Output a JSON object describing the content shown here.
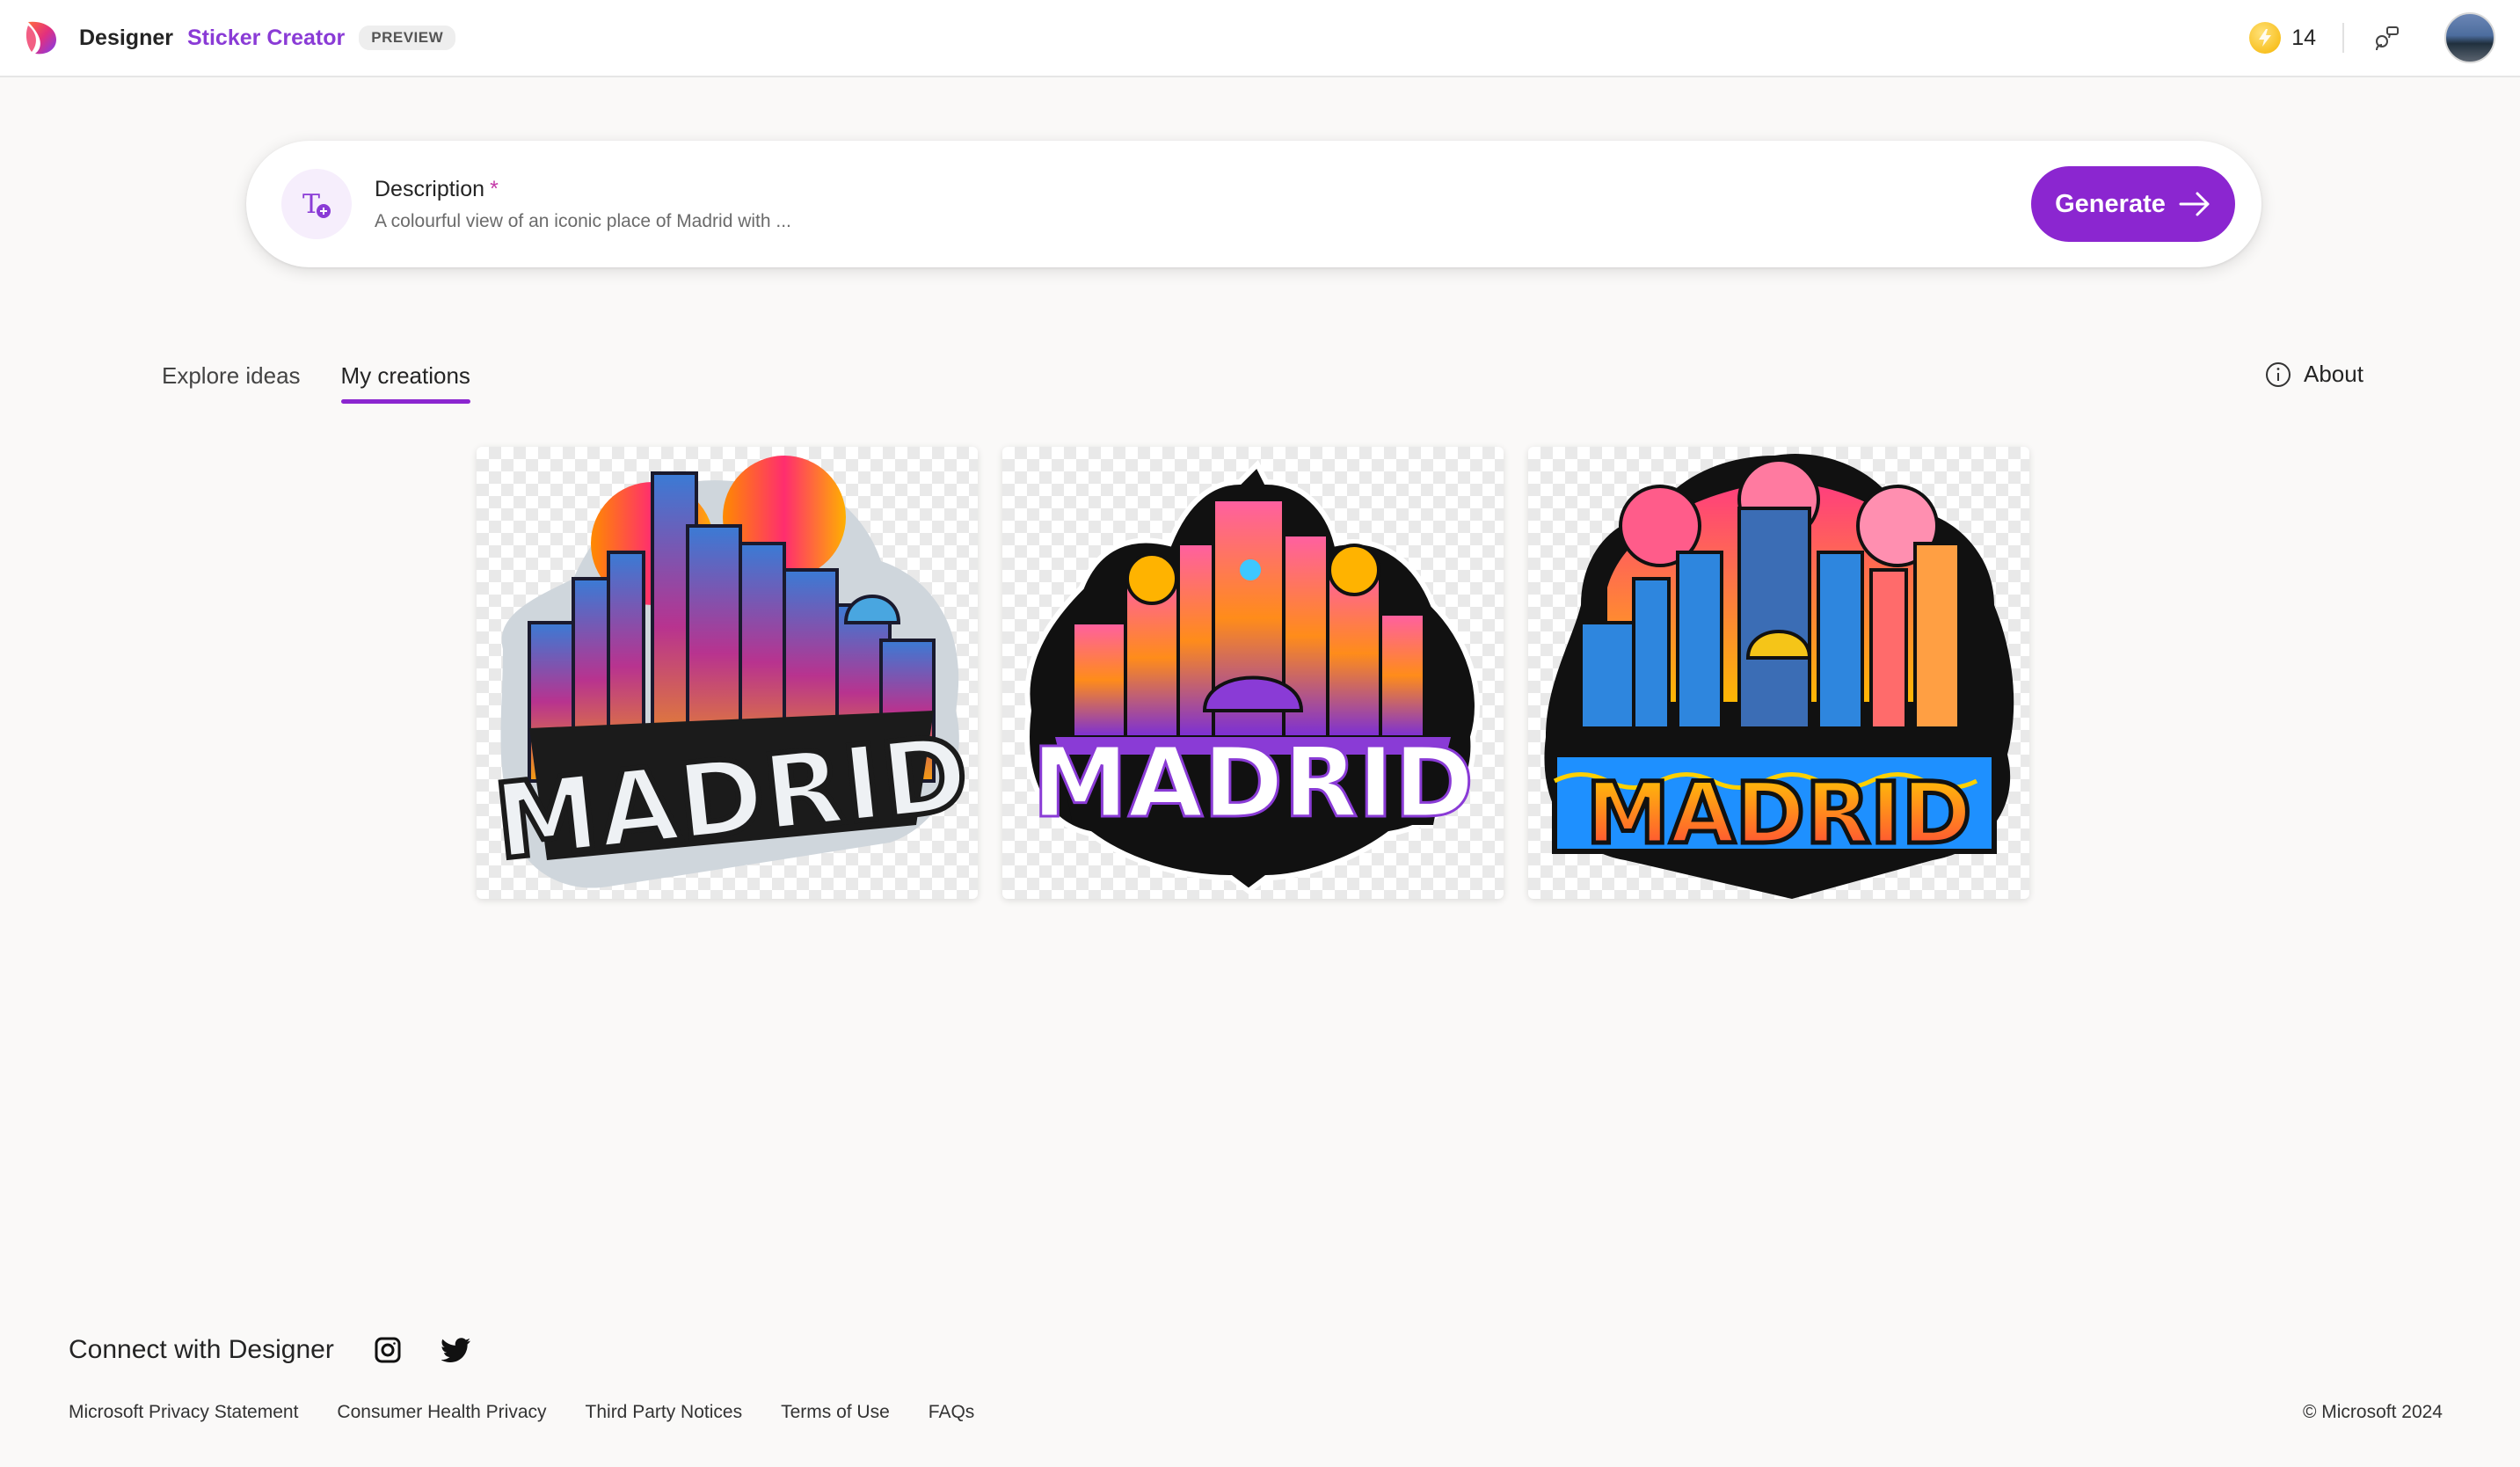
{
  "header": {
    "brand": "Designer",
    "product": "Sticker Creator",
    "badge": "PREVIEW",
    "boost_count": "14"
  },
  "prompt": {
    "label": "Description",
    "required_mark": "*",
    "value": "A colourful view of an iconic place of Madrid with ...",
    "generate_label": "Generate"
  },
  "tabs": [
    {
      "label": "Explore ideas",
      "active": false
    },
    {
      "label": "My creations",
      "active": true
    }
  ],
  "about_label": "About",
  "creations": [
    {
      "text": "MADRID"
    },
    {
      "text": "MADRID"
    },
    {
      "text": "MADRID"
    }
  ],
  "footer": {
    "connect_label": "Connect with Designer",
    "links": [
      "Microsoft Privacy Statement",
      "Consumer Health Privacy",
      "Third Party Notices",
      "Terms of Use",
      "FAQs"
    ],
    "copyright": "© Microsoft 2024"
  },
  "colors": {
    "accent": "#8b26d0",
    "product": "#8a3bd6"
  }
}
